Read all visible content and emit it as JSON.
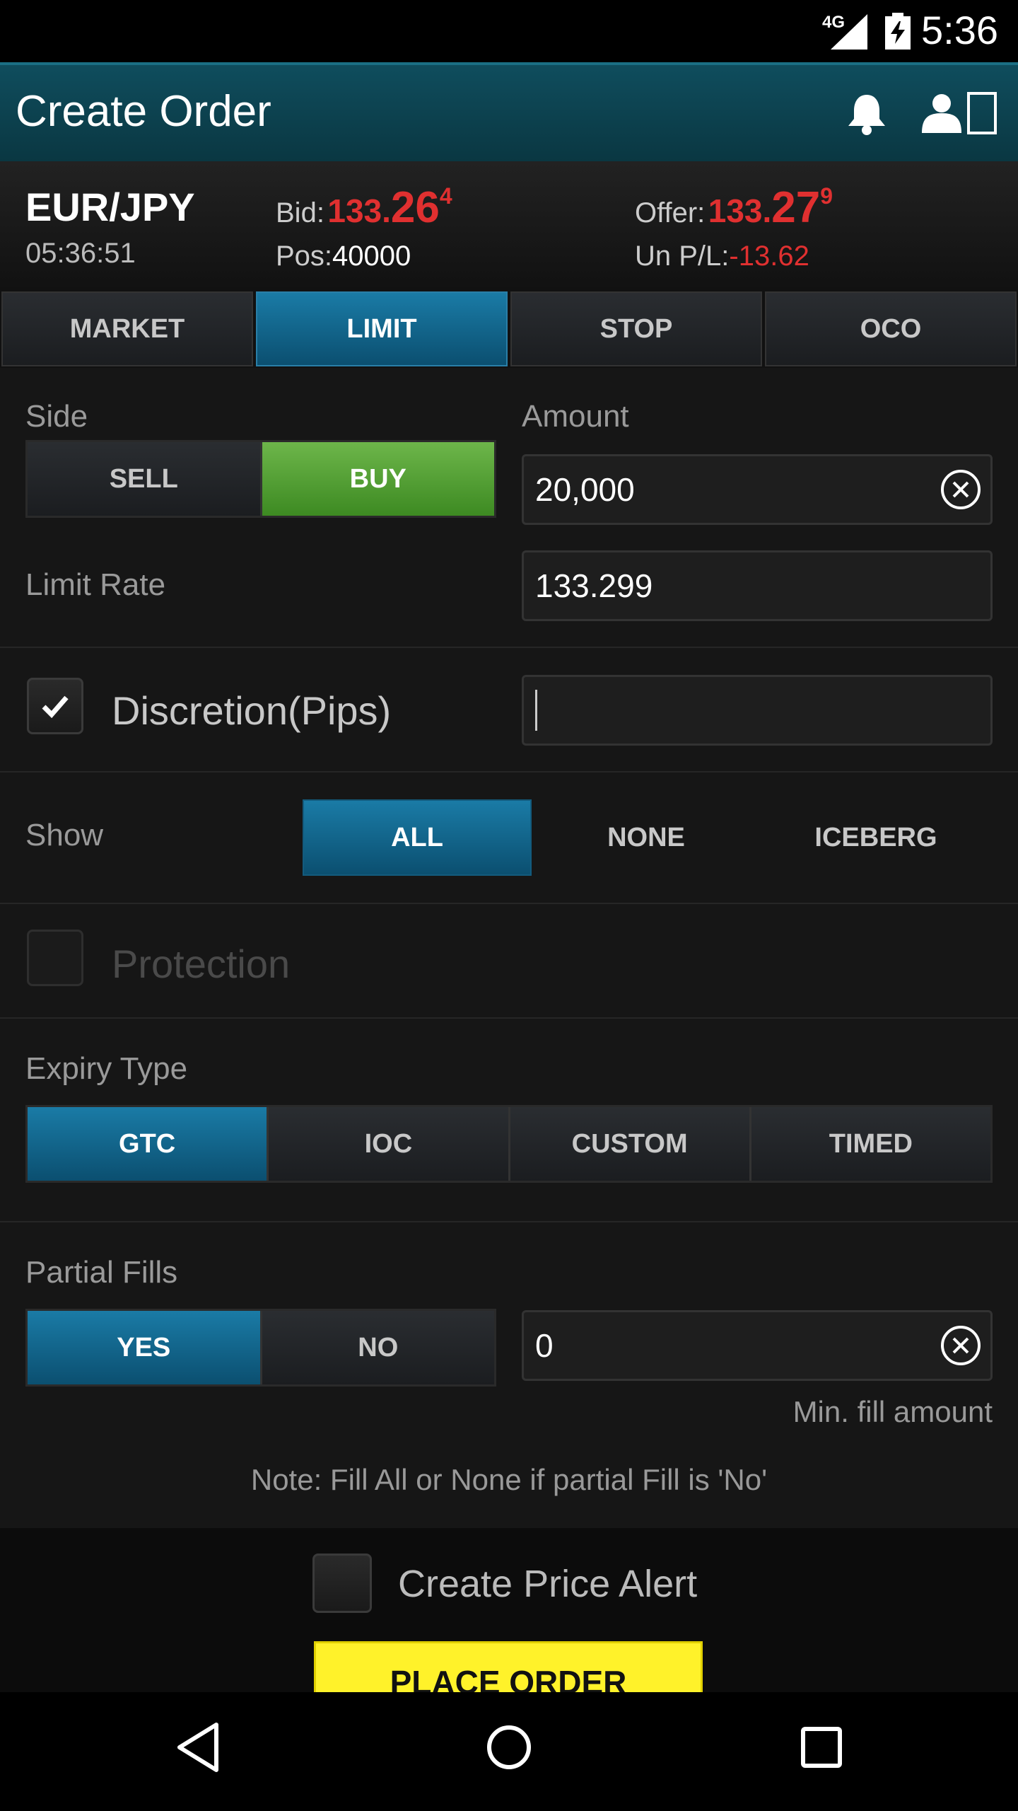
{
  "status": {
    "network": "4G",
    "time": "5:36"
  },
  "appbar": {
    "title": "Create Order"
  },
  "quote": {
    "pair": "EUR/JPY",
    "time": "05:36:51",
    "bid_label": "Bid:",
    "bid_prefix": "133.",
    "bid_big": "26",
    "bid_pip": "4",
    "offer_label": "Offer:",
    "offer_prefix": "133.",
    "offer_big": "27",
    "offer_pip": "9",
    "pos_label": "Pos:",
    "pos_value": "40000",
    "upl_label": "Un P/L:",
    "upl_value": "-13.62"
  },
  "tabs": [
    "MARKET",
    "LIMIT",
    "STOP",
    "OCO"
  ],
  "side": {
    "label": "Side",
    "sell": "SELL",
    "buy": "BUY"
  },
  "amount": {
    "label": "Amount",
    "value": "20,000"
  },
  "limit_rate": {
    "label": "Limit Rate",
    "value": "133.299"
  },
  "discretion": {
    "label": "Discretion(Pips)",
    "checked": true,
    "value": ""
  },
  "show": {
    "label": "Show",
    "options": [
      "ALL",
      "NONE",
      "ICEBERG"
    ]
  },
  "protection": {
    "label": "Protection"
  },
  "expiry": {
    "label": "Expiry Type",
    "options": [
      "GTC",
      "IOC",
      "CUSTOM",
      "TIMED"
    ]
  },
  "partial": {
    "label": "Partial Fills",
    "yes": "YES",
    "no": "NO",
    "min_value": "0",
    "min_hint": "Min. fill amount",
    "note": "Note: Fill All or None if partial Fill is 'No'"
  },
  "footer": {
    "alert_label": "Create Price Alert",
    "place_order": "PLACE ORDER"
  },
  "colors": {
    "accent_blue": "#0b4f70",
    "buy_green": "#4a9a2c",
    "price_red": "#e03030",
    "place_yellow": "#fff22a"
  }
}
